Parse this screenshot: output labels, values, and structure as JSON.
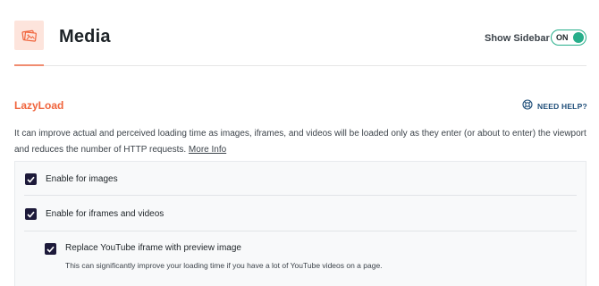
{
  "header": {
    "title": "Media",
    "icon": "media-images-icon",
    "sidebar_label": "Show Sidebar",
    "sidebar_toggle": "ON"
  },
  "section": {
    "title": "LazyLoad",
    "help_label": "NEED HELP?",
    "description": "It can improve actual and perceived loading time as images, iframes, and videos will be loaded only as they enter (or about to enter) the viewport and reduces the number of HTTP requests.",
    "more_info": "More Info"
  },
  "options": {
    "images": {
      "label": "Enable for images",
      "checked": true
    },
    "iframes": {
      "label": "Enable for iframes and videos",
      "checked": true
    },
    "youtube": {
      "label": "Replace YouTube iframe with preview image",
      "hint": "This can significantly improve your loading time if you have a lot of YouTube videos on a page.",
      "checked": true
    }
  },
  "colors": {
    "accent": "#f0643c",
    "toggle_on": "#27ae8a",
    "checkbox": "#1d1a3a",
    "help_link": "#1f4e79"
  }
}
